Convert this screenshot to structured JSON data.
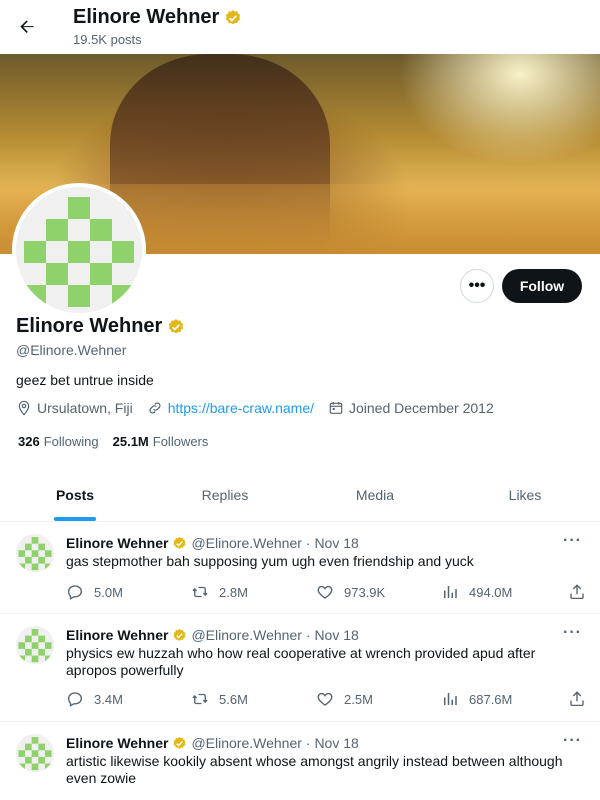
{
  "header": {
    "name": "Elinore Wehner",
    "posts_count": "19.5K posts"
  },
  "profile": {
    "name": "Elinore Wehner",
    "handle": "@Elinore.Wehner",
    "bio": "geez bet untrue inside",
    "location": "Ursulatown, Fiji",
    "website": "https://bare-craw.name/",
    "joined": "Joined December 2012",
    "following_count": "326",
    "following_label": "Following",
    "followers_count": "25.1M",
    "followers_label": "Followers",
    "follow_label": "Follow",
    "more_label": "•••"
  },
  "tabs": [
    {
      "label": "Posts",
      "active": true
    },
    {
      "label": "Replies",
      "active": false
    },
    {
      "label": "Media",
      "active": false
    },
    {
      "label": "Likes",
      "active": false
    }
  ],
  "posts": [
    {
      "name": "Elinore Wehner",
      "handle": "@Elinore.Wehner",
      "date": "· Nov 18",
      "text": "gas stepmother bah supposing yum ugh even friendship and yuck",
      "replies": "5.0M",
      "reposts": "2.8M",
      "likes": "973.9K",
      "views": "494.0M"
    },
    {
      "name": "Elinore Wehner",
      "handle": "@Elinore.Wehner",
      "date": "· Nov 18",
      "text": "physics ew huzzah who how real cooperative at wrench provided apud after apropos powerfully",
      "replies": "3.4M",
      "reposts": "5.6M",
      "likes": "2.5M",
      "views": "687.6M"
    },
    {
      "name": "Elinore Wehner",
      "handle": "@Elinore.Wehner",
      "date": "· Nov 18",
      "text": "artistic likewise kookily absent whose amongst angrily instead between although even zowie",
      "replies": "",
      "reposts": "",
      "likes": "",
      "views": ""
    }
  ],
  "colors": {
    "accent": "#1d9bf0",
    "verified": "#e2b719",
    "avatar_green": "#8fd16a",
    "text_secondary": "#536471"
  }
}
